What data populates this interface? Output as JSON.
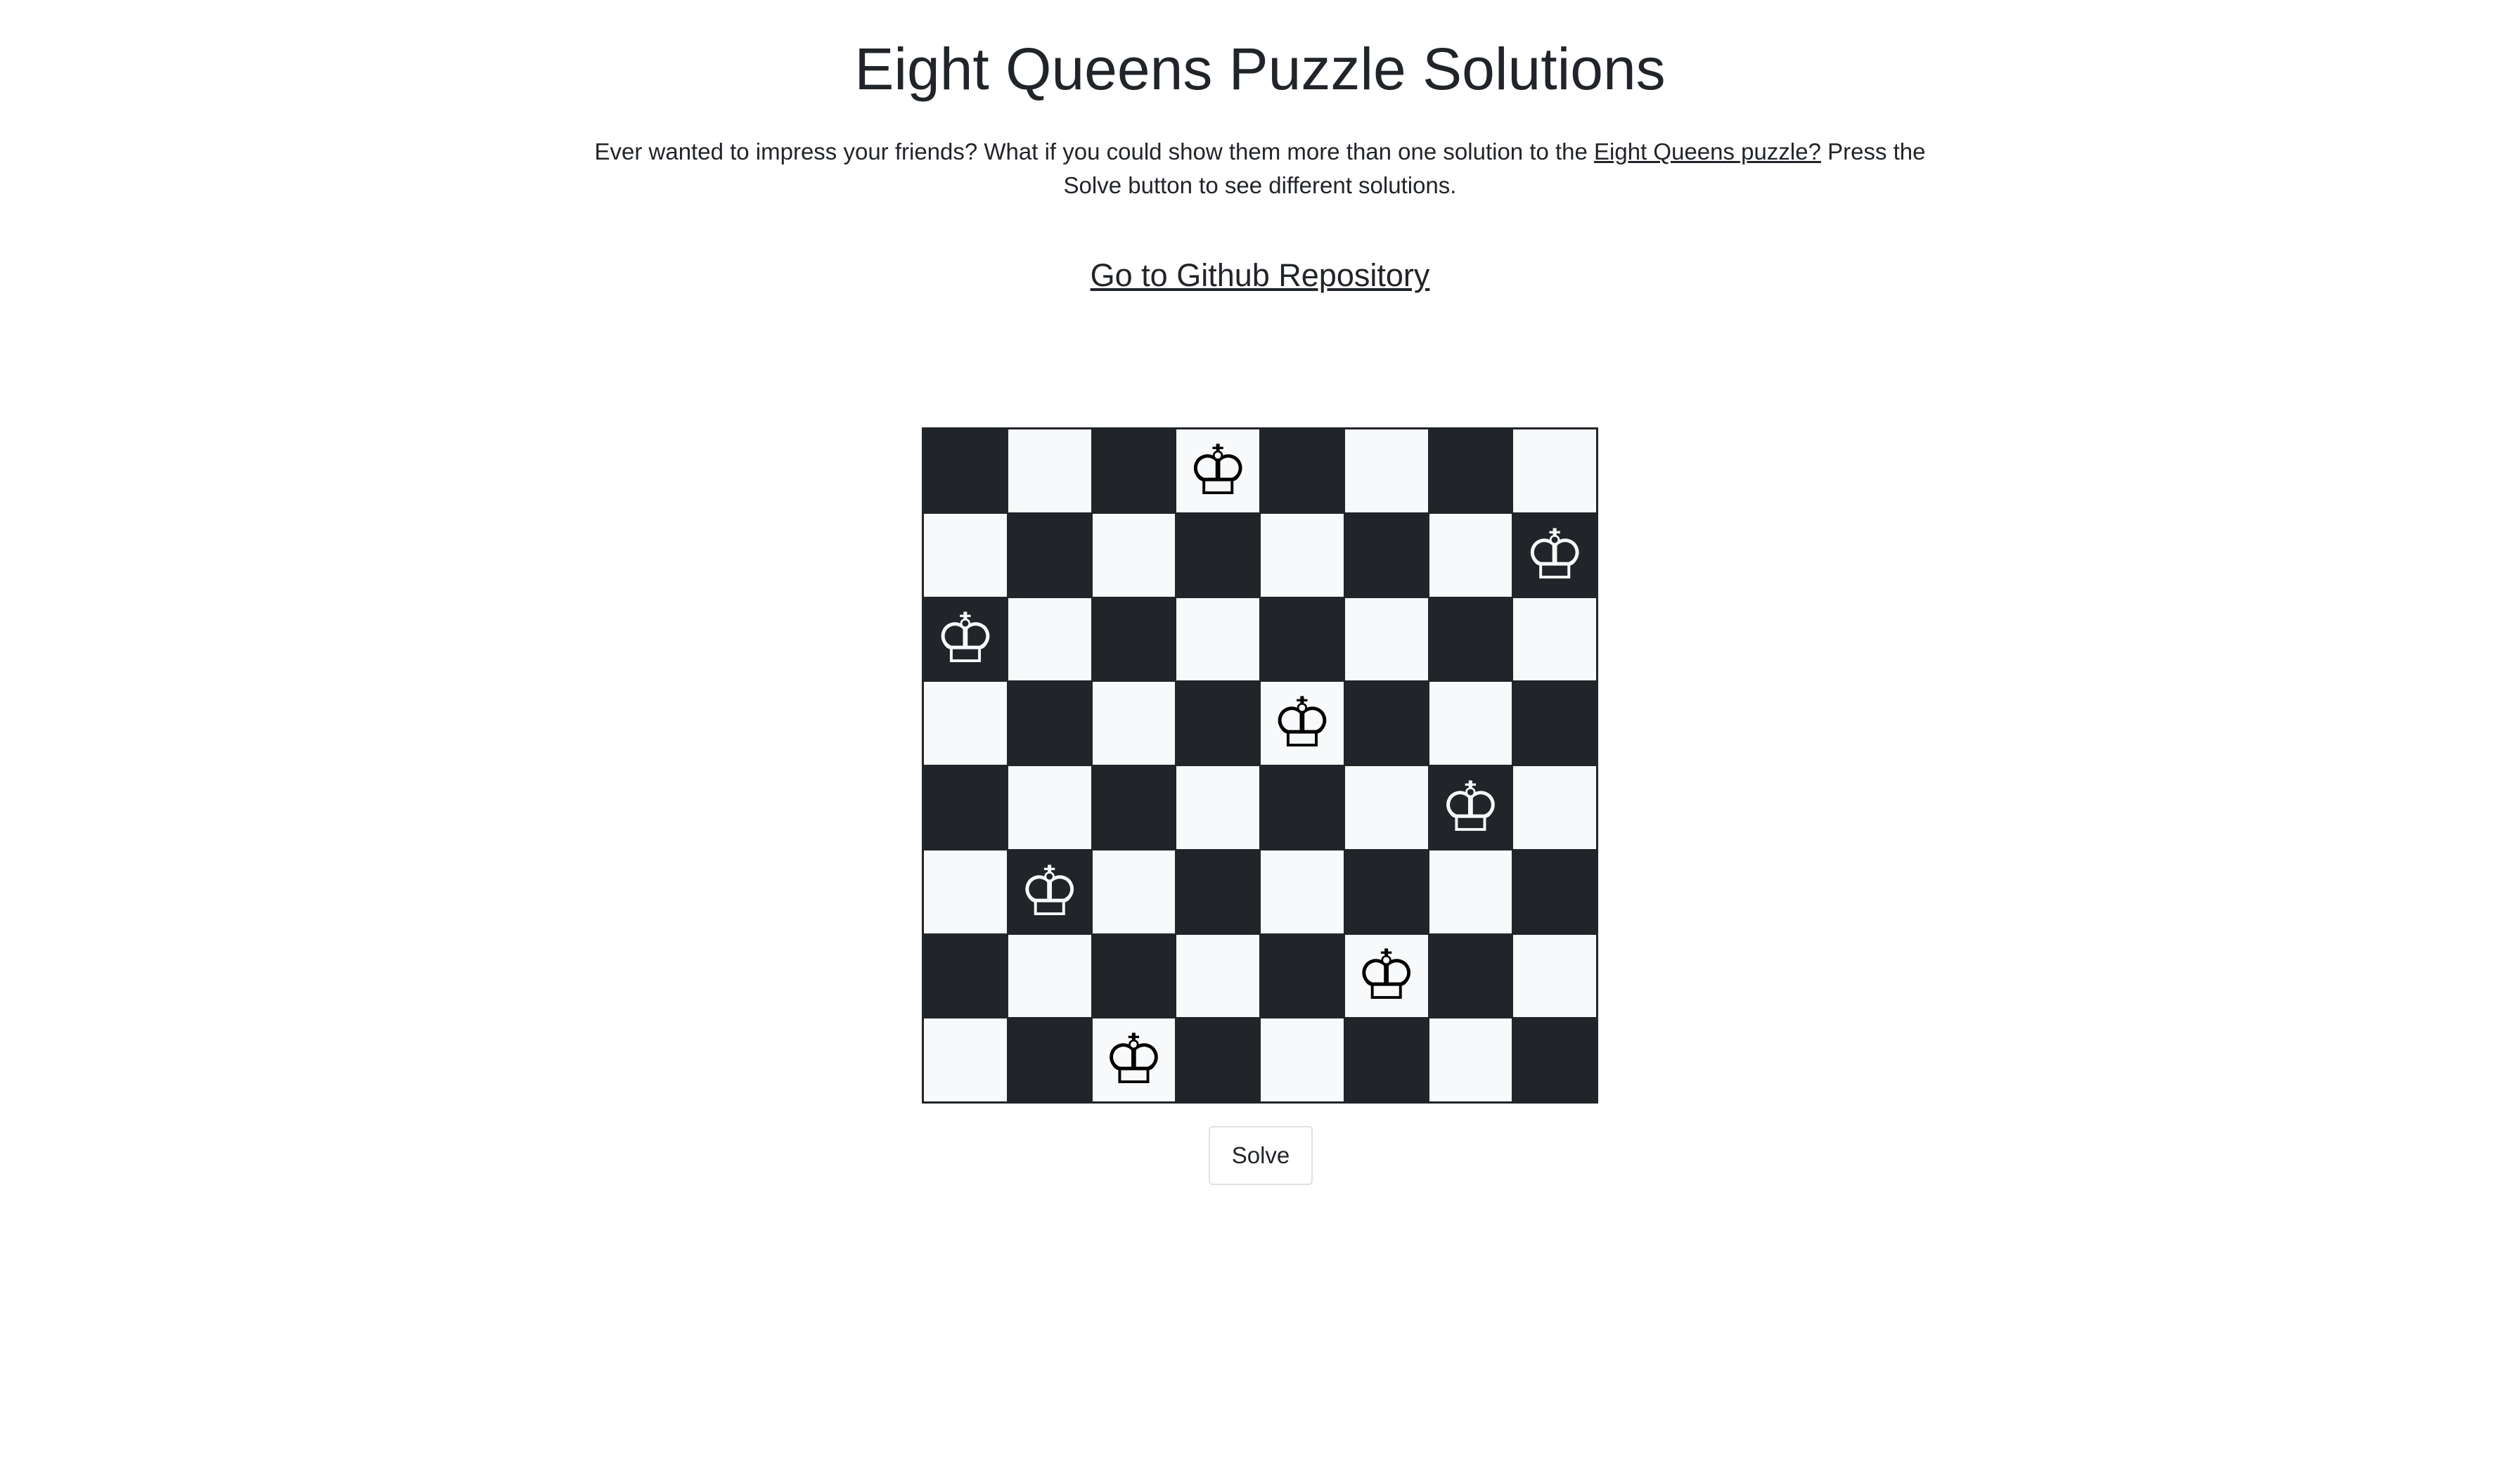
{
  "header": {
    "title": "Eight Queens Puzzle Solutions"
  },
  "intro": {
    "text_before_link": "Ever wanted to impress your friends? What if you could show them more than one solution to the ",
    "link_text": "Eight Queens puzzle?",
    "text_after_link": " Press the Solve button to see different solutions."
  },
  "repo_link": {
    "label": "Go to Github Repository"
  },
  "board": {
    "size": 8,
    "queen_glyph": "♔",
    "queen_icon": "queen-crown-icon",
    "queen_columns_by_row": [
      3,
      7,
      0,
      4,
      6,
      1,
      5,
      2
    ]
  },
  "colors": {
    "dark_square": "#212529",
    "light_square": "#f8f9fa"
  },
  "actions": {
    "solve_label": "Solve"
  }
}
